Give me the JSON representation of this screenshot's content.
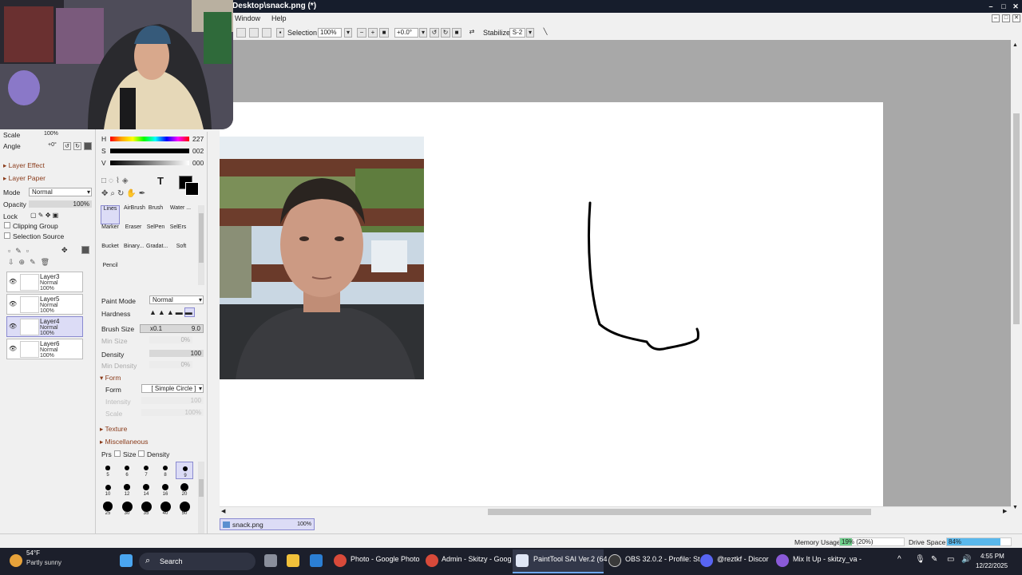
{
  "window": {
    "title": "Desktop\\snack.png (*)",
    "controls": [
      "–",
      "□",
      "✕"
    ]
  },
  "menu": {
    "window": "Window",
    "help": "Help"
  },
  "toolbar": {
    "selection_label": "Selection",
    "zoom": "100%",
    "rotation": "+0.0°",
    "stabilizer_label": "Stabilizer",
    "stabilizer_value": "S-2"
  },
  "left_panel": {
    "scale_label": "Scale",
    "scale_value": "100%",
    "angle_label": "Angle",
    "angle_value": "+0°",
    "layer_effect": "Layer Effect",
    "layer_paper": "Layer Paper",
    "mode_label": "Mode",
    "mode_value": "Normal",
    "opacity_label": "Opacity",
    "opacity_value": "100%",
    "lock_label": "Lock",
    "clipping_group": "Clipping Group",
    "selection_source": "Selection Source",
    "layers": [
      {
        "name": "Layer3",
        "mode": "Normal",
        "opacity": "100%"
      },
      {
        "name": "Layer5",
        "mode": "Normal",
        "opacity": "100%"
      },
      {
        "name": "Layer4",
        "mode": "Normal",
        "opacity": "100%"
      },
      {
        "name": "Layer6",
        "mode": "Normal",
        "opacity": "100%"
      }
    ]
  },
  "color": {
    "h_label": "H",
    "h_value": "227",
    "s_label": "S",
    "s_value": "002",
    "v_label": "V",
    "v_value": "000",
    "foreground": "#000000"
  },
  "tools": [
    {
      "name": "Lines"
    },
    {
      "name": "AirBrush"
    },
    {
      "name": "Brush"
    },
    {
      "name": "Water ..."
    },
    {
      "name": "Marker"
    },
    {
      "name": "Eraser"
    },
    {
      "name": "SelPen"
    },
    {
      "name": "SelErs"
    },
    {
      "name": "Bucket"
    },
    {
      "name": "Binary..."
    },
    {
      "name": "Gradat..."
    },
    {
      "name": "Soft"
    },
    {
      "name": "Pencil"
    }
  ],
  "brush": {
    "paint_mode_label": "Paint Mode",
    "paint_mode_value": "Normal",
    "hardness_label": "Hardness",
    "brush_size_label": "Brush Size",
    "brush_size_mult": "x0.1",
    "brush_size_value": "9.0",
    "min_size_label": "Min Size",
    "min_size_value": "0%",
    "density_label": "Density",
    "density_value": "100",
    "min_density_label": "Min Density",
    "min_density_value": "0%",
    "form_section": "Form",
    "form_label": "Form",
    "form_value": "[ Simple Circle ]",
    "intensity_label": "Intensity",
    "intensity_value": "100",
    "scale_label": "Scale",
    "scale_value": "100%",
    "texture_section": "Texture",
    "misc_section": "Miscellaneous",
    "prs_label": "Prs",
    "size_label": "Size",
    "density_chk_label": "Density"
  },
  "brush_sizes": [
    "5",
    "6",
    "7",
    "8",
    "9",
    "10",
    "12",
    "14",
    "16",
    "20",
    "25",
    "30",
    "35",
    "40",
    "50"
  ],
  "document_tab": {
    "name": "snack.png",
    "zoom": "100%"
  },
  "status": {
    "memory_label": "Memory Usage",
    "memory_value": "19% (20%)",
    "memory_fraction": 0.19,
    "drive_label": "Drive Space",
    "drive_value": "84%",
    "drive_fraction": 0.84
  },
  "taskbar": {
    "weather_temp": "54°F",
    "weather_desc": "Partly sunny",
    "search": "Search",
    "apps": [
      "Photo - Google Photo",
      "Admin - Skitzy - Goog",
      "PaintTool SAI Ver.2 (64",
      "OBS 32.0.2 - Profile: St",
      "@reztkf - Discor",
      "Mix It Up - skitzy_va - "
    ],
    "time": "4:55 PM",
    "date": "12/22/2025"
  }
}
